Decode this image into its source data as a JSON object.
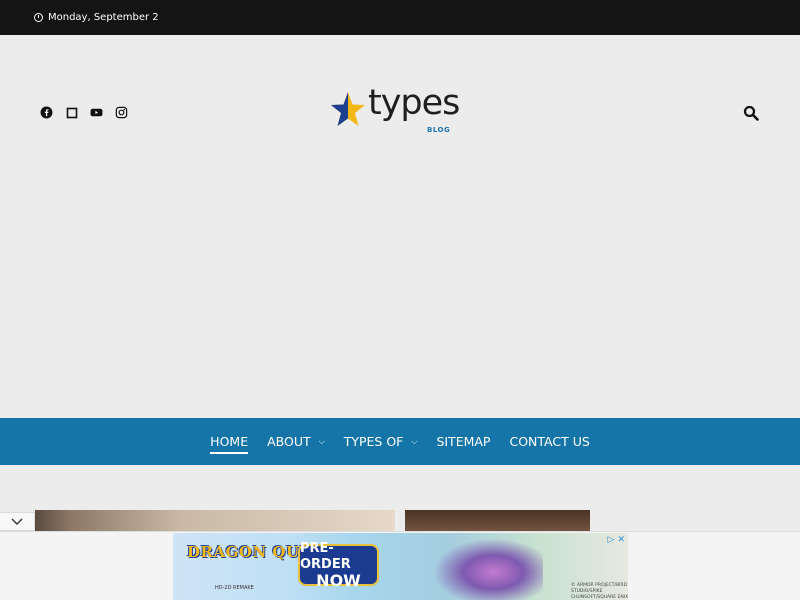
{
  "topbar": {
    "date": "Monday, September 2"
  },
  "social_icons": [
    "facebook-icon",
    "square-icon",
    "youtube-icon",
    "instagram-icon"
  ],
  "logo": {
    "word": "types",
    "tagline": "BLOG"
  },
  "nav": {
    "items": [
      {
        "label": "HOME",
        "active": true,
        "dropdown": false
      },
      {
        "label": "ABOUT",
        "active": false,
        "dropdown": true
      },
      {
        "label": "TYPES OF",
        "active": false,
        "dropdown": true
      },
      {
        "label": "SITEMAP",
        "active": false,
        "dropdown": false
      },
      {
        "label": "CONTACT US",
        "active": false,
        "dropdown": false
      }
    ]
  },
  "ad": {
    "title": "DRAGON QUEST III",
    "subtitle": "HD-2D REMAKE",
    "cta_line1": "PRE-ORDER",
    "cta_line2": "NOW",
    "credit": "© ARMOR PROJECT/BIRD STUDIO/SPIKE CHUNSOFT/SQUARE ENIX"
  },
  "colors": {
    "topbar": "#141414",
    "nav": "#1575a8",
    "page": "#ececec",
    "accent_blue": "#1b73b3",
    "logo_star": "#f2b818"
  }
}
